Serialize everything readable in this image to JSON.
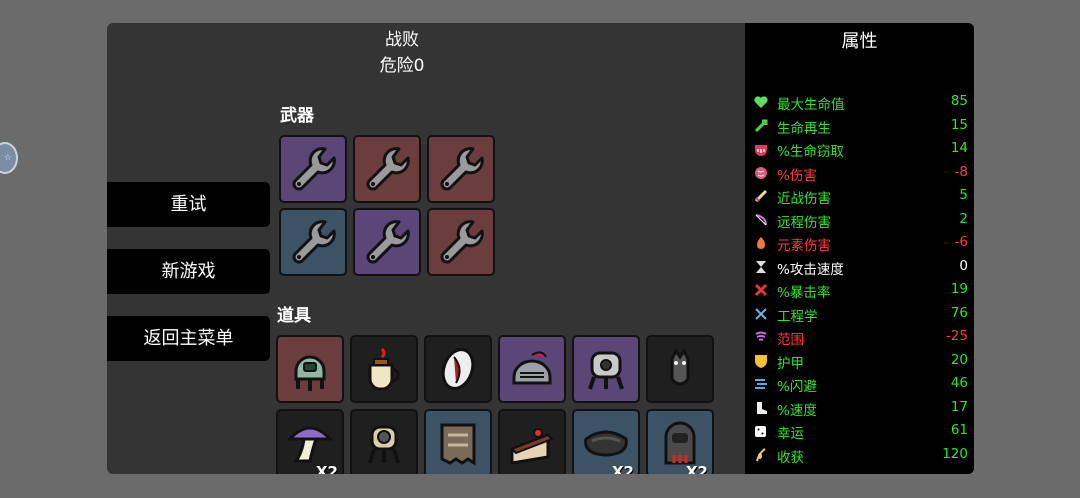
{
  "header": {
    "result": "战败",
    "danger": "危险0"
  },
  "menu": {
    "retry": "重试",
    "new_game": "新游戏",
    "main_menu": "返回主菜单"
  },
  "weapons": {
    "label": "武器",
    "slots": [
      {
        "icon": "wrench-icon",
        "color": "#5a4677"
      },
      {
        "icon": "wrench-icon",
        "color": "#6c3d3d"
      },
      {
        "icon": "wrench-icon",
        "color": "#6c3d3d"
      },
      {
        "icon": "wrench-icon",
        "color": "#3c5366"
      },
      {
        "icon": "wrench-icon",
        "color": "#5a4677"
      },
      {
        "icon": "wrench-icon",
        "color": "#6c3d3d"
      }
    ]
  },
  "items": {
    "label": "道具",
    "slots": [
      {
        "icon": "turret-robot-icon",
        "color": "#6c3d3d"
      },
      {
        "icon": "coffee-cup-icon",
        "color": "#1f1f1f"
      },
      {
        "icon": "fang-mouth-icon",
        "color": "#1f1f1f"
      },
      {
        "icon": "knight-helmet-icon",
        "color": "#5a4677"
      },
      {
        "icon": "engineering-turret-icon",
        "color": "#5a4677"
      },
      {
        "icon": "bat-icon",
        "color": "#1f1f1f"
      },
      {
        "icon": "mushroom-icon",
        "color": "#1f1f1f",
        "qty": "X2"
      },
      {
        "icon": "tripod-robot-icon",
        "color": "#1f1f1f"
      },
      {
        "icon": "ragged-cloth-icon",
        "color": "#3c5366"
      },
      {
        "icon": "cake-slice-icon",
        "color": "#1f1f1f"
      },
      {
        "icon": "scarf-icon",
        "color": "#3c5366",
        "qty": "X2"
      },
      {
        "icon": "hooded-robot-icon",
        "color": "#3c5366",
        "qty": "X2"
      }
    ]
  },
  "stats": {
    "title": "属性",
    "rows": [
      {
        "icon": "heart-icon",
        "name": "最大生命值",
        "value": "85",
        "tone": "green"
      },
      {
        "icon": "health-regen-icon",
        "name": "生命再生",
        "value": "15",
        "tone": "green"
      },
      {
        "icon": "lifesteal-icon",
        "name": "%生命窃取",
        "value": "14",
        "tone": "green"
      },
      {
        "icon": "brain-icon",
        "name": "%伤害",
        "value": "-8",
        "tone": "red"
      },
      {
        "icon": "sword-icon",
        "name": "近战伤害",
        "value": "5",
        "tone": "green"
      },
      {
        "icon": "bow-icon",
        "name": "远程伤害",
        "value": "2",
        "tone": "green"
      },
      {
        "icon": "flame-icon",
        "name": "元素伤害",
        "value": "-6",
        "tone": "red"
      },
      {
        "icon": "hourglass-icon",
        "name": "%攻击速度",
        "value": "0",
        "tone": "white"
      },
      {
        "icon": "crit-icon",
        "name": "%暴击率",
        "value": "19",
        "tone": "green"
      },
      {
        "icon": "tools-icon",
        "name": "工程学",
        "value": "76",
        "tone": "green"
      },
      {
        "icon": "range-icon",
        "name": "范围",
        "value": "-25",
        "tone": "red"
      },
      {
        "icon": "shield-icon",
        "name": "护甲",
        "value": "20",
        "tone": "green"
      },
      {
        "icon": "dodge-icon",
        "name": "%闪避",
        "value": "46",
        "tone": "green"
      },
      {
        "icon": "boot-icon",
        "name": "%速度",
        "value": "17",
        "tone": "green"
      },
      {
        "icon": "dice-icon",
        "name": "幸运",
        "value": "61",
        "tone": "green"
      },
      {
        "icon": "harvest-icon",
        "name": "收获",
        "value": "120",
        "tone": "green"
      }
    ]
  }
}
